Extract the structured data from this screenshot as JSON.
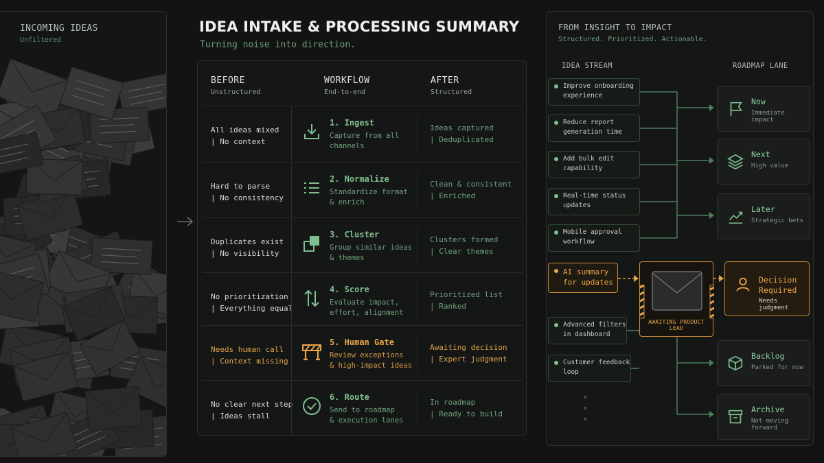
{
  "left_panel": {
    "title": "INCOMING IDEAS",
    "subtitle": "Unfiltered"
  },
  "header": {
    "title": "IDEA INTAKE & PROCESSING SUMMARY",
    "subtitle": "Turning noise into direction."
  },
  "table": {
    "columns": [
      {
        "heading": "BEFORE",
        "sub": "Unstructured"
      },
      {
        "heading": "WORKFLOW",
        "sub": "End-to-end"
      },
      {
        "heading": "AFTER",
        "sub": "Structured"
      }
    ],
    "rows": [
      {
        "before": "All ideas mixed\n| No context",
        "icon": "download-icon",
        "title": "1. Ingest",
        "desc": "Capture from all\nchannels",
        "after": "Ideas captured\n| Deduplicated",
        "highlight": false
      },
      {
        "before": "Hard to parse\n| No consistency",
        "icon": "list-icon",
        "title": "2. Normalize",
        "desc": "Standardize format\n& enrich",
        "after": "Clean & consistent\n| Enriched",
        "highlight": false
      },
      {
        "before": "Duplicates exist\n| No visibility",
        "icon": "cluster-icon",
        "title": "3. Cluster",
        "desc": "Group similar ideas\n& themes",
        "after": "Clusters formed\n| Clear themes",
        "highlight": false
      },
      {
        "before": "No prioritization\n| Everything equal",
        "icon": "sort-arrows-icon",
        "title": "4. Score",
        "desc": "Evaluate impact,\neffort, alignment",
        "after": "Prioritized list\n| Ranked",
        "highlight": false
      },
      {
        "before": "Needs human call\n| Context missing",
        "icon": "barrier-icon",
        "title": "5. Human Gate",
        "desc": "Review exceptions\n& high-impact ideas",
        "after": "Awaiting decision\n| Expert judgment",
        "highlight": true
      },
      {
        "before": "No clear next step\n| Ideas stall",
        "icon": "check-circle-icon",
        "title": "6. Route",
        "desc": "Send to roadmap\n& execution lanes",
        "after": "In roadmap\n| Ready to build",
        "highlight": false
      }
    ]
  },
  "right_panel": {
    "title": "FROM INSIGHT TO IMPACT",
    "subtitle": "Structured. Prioritized. Actionable.",
    "idea_stream_label": "IDEA STREAM",
    "roadmap_lane_label": "ROADMAP LANE",
    "ideas": [
      {
        "text": "Improve onboarding\nexperience",
        "highlight": false
      },
      {
        "text": "Reduce report\ngeneration time",
        "highlight": false
      },
      {
        "text": "Add bulk edit\ncapability",
        "highlight": false
      },
      {
        "text": "Real-time status\nupdates",
        "highlight": false
      },
      {
        "text": "Mobile approval\nworkflow",
        "highlight": false
      },
      {
        "text": "AI summary\nfor updates",
        "highlight": true
      },
      {
        "text": "Advanced filters\nin dashboard",
        "highlight": false
      },
      {
        "text": "Customer feedback\nloop",
        "highlight": false
      }
    ],
    "gate_label": "AWAITING PRODUCT LEAD",
    "lanes": [
      {
        "title": "Now",
        "sub": "Immediate impact",
        "icon": "flag-icon",
        "highlight": false
      },
      {
        "title": "Next",
        "sub": "High value",
        "icon": "layers-icon",
        "highlight": false
      },
      {
        "title": "Later",
        "sub": "Strategic bets",
        "icon": "trend-up-icon",
        "highlight": false
      },
      {
        "title": "Decision\nRequired",
        "sub": "Needs judgment",
        "icon": "person-icon",
        "highlight": true
      },
      {
        "title": "Backlog",
        "sub": "Parked for now",
        "icon": "cube-icon",
        "highlight": false
      },
      {
        "title": "Archive",
        "sub": "Not moving forward",
        "icon": "archive-box-icon",
        "highlight": false
      }
    ]
  },
  "colors": {
    "background": "#121312",
    "accent_green": "#7fbf8f",
    "accent_amber": "#e9a547"
  }
}
